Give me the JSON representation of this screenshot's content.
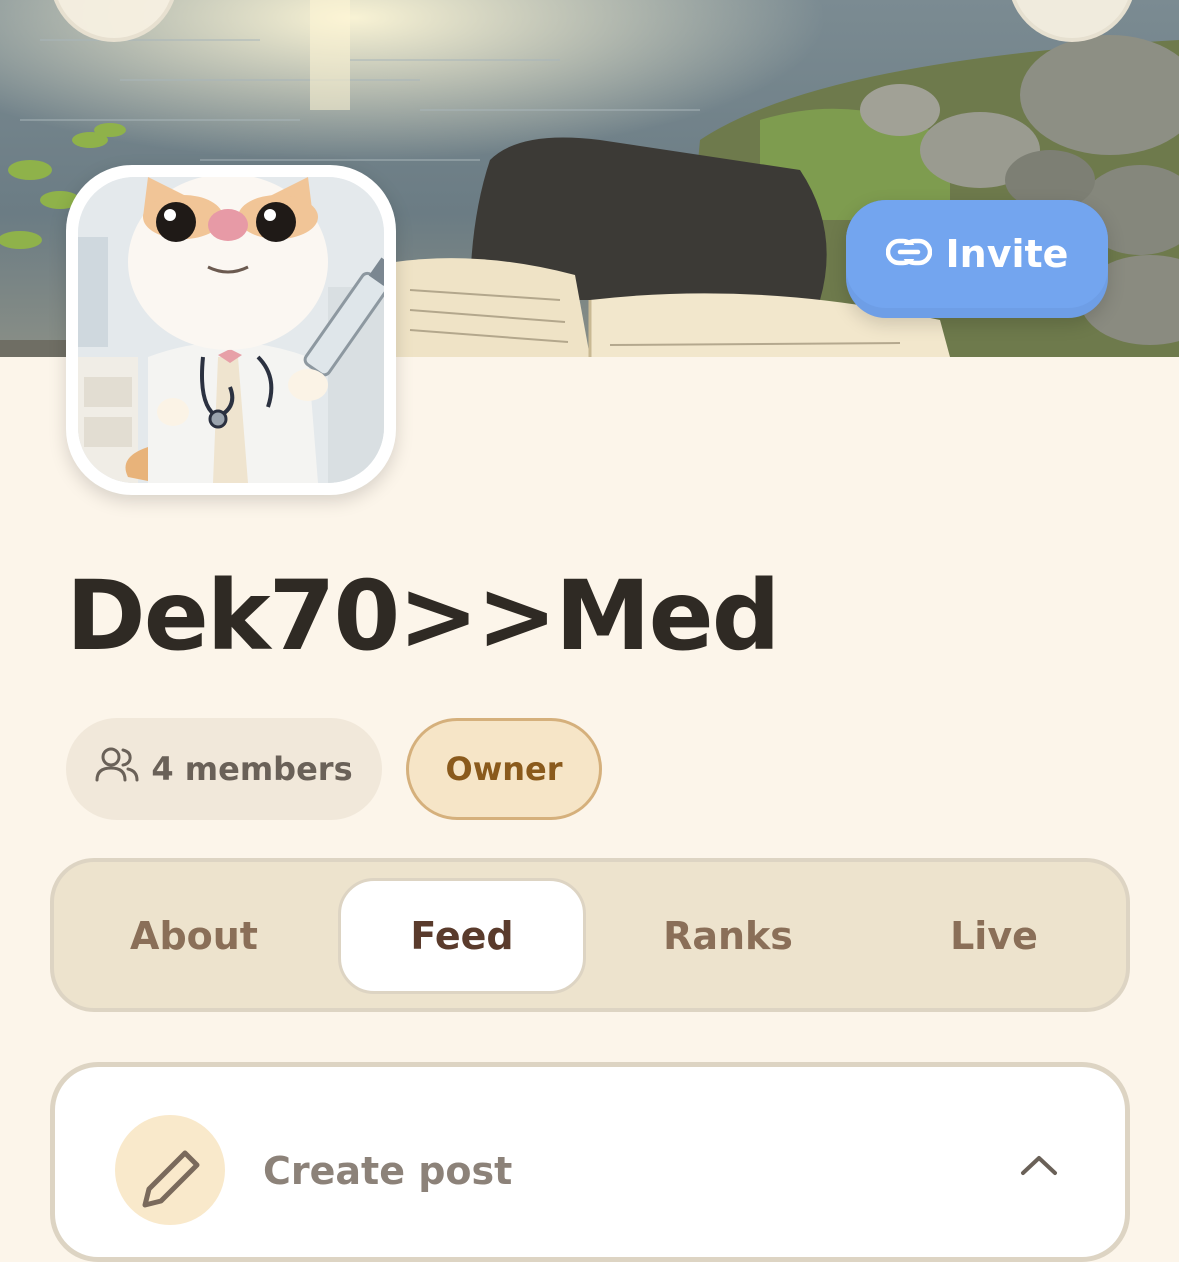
{
  "header": {
    "invite_label": "Invite"
  },
  "group": {
    "title": "Dek70>>Med",
    "members_label": "4 members",
    "role_label": "Owner"
  },
  "tabs": [
    {
      "label": "About",
      "active": false
    },
    {
      "label": "Feed",
      "active": true
    },
    {
      "label": "Ranks",
      "active": false
    },
    {
      "label": "Live",
      "active": false
    }
  ],
  "create_post": {
    "label": "Create post"
  },
  "colors": {
    "background": "#fcf5ea",
    "invite_button": "#73a5ef",
    "owner_chip": "#f6e5c7",
    "tab_bar": "#ede3cd",
    "title_text": "#2f2a24"
  },
  "icons": {
    "invite": "link-icon",
    "members": "users-icon",
    "create_post": "pencil-icon",
    "collapse": "chevron-up-icon"
  }
}
